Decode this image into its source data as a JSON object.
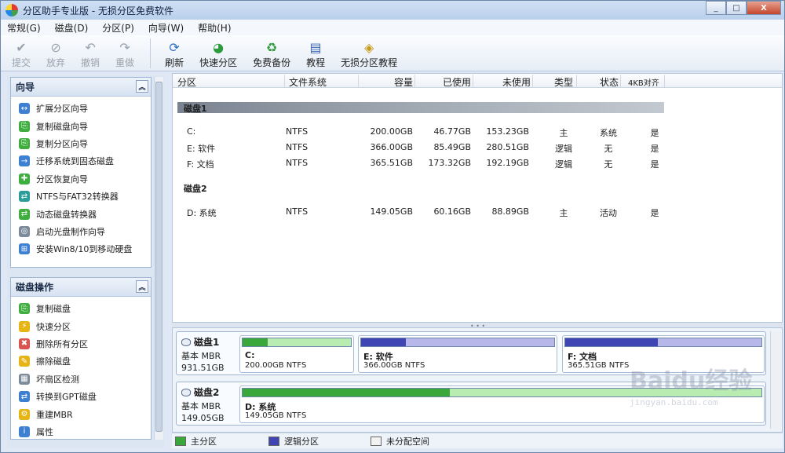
{
  "window": {
    "title": "分区助手专业版 - 无损分区免费软件",
    "controls": [
      "_",
      "□",
      "X"
    ]
  },
  "menu": [
    "常规(G)",
    "磁盘(D)",
    "分区(P)",
    "向导(W)",
    "帮助(H)"
  ],
  "toolbar": {
    "buttons": [
      {
        "label": "提交",
        "icon": "check-icon",
        "enabled": false
      },
      {
        "label": "放弃",
        "icon": "discard-icon",
        "enabled": false
      },
      {
        "label": "撤销",
        "icon": "undo-icon",
        "enabled": false
      },
      {
        "label": "重做",
        "icon": "redo-icon",
        "enabled": false
      },
      {
        "label": "刷新",
        "icon": "refresh-icon",
        "enabled": true
      },
      {
        "label": "快速分区",
        "icon": "quick-partition-icon",
        "enabled": true
      },
      {
        "label": "免费备份",
        "icon": "backup-icon",
        "enabled": true
      },
      {
        "label": "教程",
        "icon": "tutorial-icon",
        "enabled": true
      },
      {
        "label": "无损分区教程",
        "icon": "lossless-tutorial-icon",
        "enabled": true
      }
    ]
  },
  "sidebar": {
    "wizard_title": "向导",
    "wizard_items": [
      "扩展分区向导",
      "复制磁盘向导",
      "复制分区向导",
      "迁移系统到固态磁盘",
      "分区恢复向导",
      "NTFS与FAT32转换器",
      "动态磁盘转换器",
      "启动光盘制作向导",
      "安装Win8/10到移动硬盘"
    ],
    "disk_ops_title": "磁盘操作",
    "disk_ops_items": [
      "复制磁盘",
      "快速分区",
      "删除所有分区",
      "擦除磁盘",
      "坏扇区检测",
      "转换到GPT磁盘",
      "重建MBR",
      "属性"
    ]
  },
  "table": {
    "columns": [
      "分区",
      "文件系统",
      "容量",
      "已使用",
      "未使用",
      "类型",
      "状态",
      "4KB对齐"
    ],
    "disks": [
      {
        "name": "磁盘1",
        "rows": [
          [
            "C:",
            "NTFS",
            "200.00GB",
            "46.77GB",
            "153.23GB",
            "主",
            "系统",
            "是"
          ],
          [
            "E: 软件",
            "NTFS",
            "366.00GB",
            "85.49GB",
            "280.51GB",
            "逻辑",
            "无",
            "是"
          ],
          [
            "F: 文档",
            "NTFS",
            "365.51GB",
            "173.32GB",
            "192.19GB",
            "逻辑",
            "无",
            "是"
          ]
        ]
      },
      {
        "name": "磁盘2",
        "rows": [
          [
            "D: 系统",
            "NTFS",
            "149.05GB",
            "60.16GB",
            "88.89GB",
            "主",
            "活动",
            "是"
          ]
        ]
      }
    ]
  },
  "diskmap": {
    "disks": [
      {
        "name": "磁盘1",
        "type": "基本 MBR",
        "size": "931.51GB",
        "partitions": [
          {
            "label": "C:",
            "detail": "200.00GB NTFS",
            "kind": "primary",
            "used_fraction": 0.23
          },
          {
            "label": "E: 软件",
            "detail": "366.00GB NTFS",
            "kind": "logical",
            "used_fraction": 0.23
          },
          {
            "label": "F: 文档",
            "detail": "365.51GB NTFS",
            "kind": "logical",
            "used_fraction": 0.47
          }
        ]
      },
      {
        "name": "磁盘2",
        "type": "基本 MBR",
        "size": "149.05GB",
        "partitions": [
          {
            "label": "D: 系统",
            "detail": "149.05GB NTFS",
            "kind": "primary",
            "used_fraction": 0.4
          }
        ]
      }
    ]
  },
  "legend": [
    {
      "label": "主分区",
      "color": "#3aa73a"
    },
    {
      "label": "逻辑分区",
      "color": "#3f46b3"
    },
    {
      "label": "未分配空间",
      "color": "#f2f2f2"
    }
  ],
  "watermark": {
    "logo": "Baidu经验",
    "url": "jingyan.baidu.com"
  },
  "colors": {
    "primary_used": "#3aa73a",
    "primary_free": "#b9ecb1",
    "logical_used": "#3f46b3",
    "logical_free": "#b7b7ea"
  }
}
